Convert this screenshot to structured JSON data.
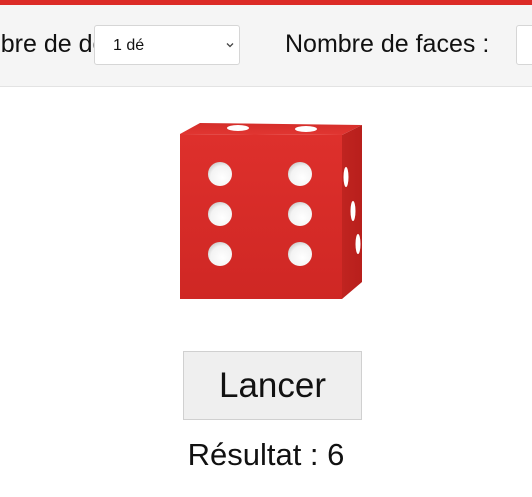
{
  "colors": {
    "accent": "#dc2b27",
    "die_face": "#d92b28",
    "pip": "#ffffff"
  },
  "controls": {
    "dice_count": {
      "label": "Nombre de dés :",
      "selected": "1 dé"
    },
    "faces": {
      "label": "Nombre de faces :"
    }
  },
  "die": {
    "value": 6
  },
  "roll_button": {
    "label": "Lancer"
  },
  "result": {
    "text": "Résultat : 6"
  }
}
